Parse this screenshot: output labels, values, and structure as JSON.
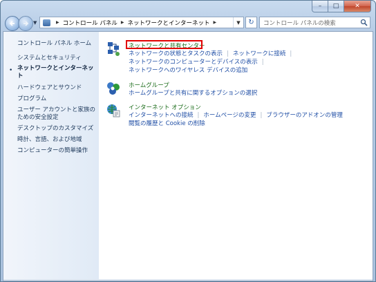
{
  "address": {
    "crumbs": [
      "コントロール パネル",
      "ネットワークとインターネット"
    ]
  },
  "search": {
    "placeholder": "コントロール パネルの検索"
  },
  "sidebar": {
    "items": [
      {
        "label": "コントロール パネル ホーム"
      },
      {
        "label": "システムとセキュリティ"
      },
      {
        "label_line1": "ネットワークとインターネッ",
        "label_line2": "ト"
      },
      {
        "label": "ハードウェアとサウンド"
      },
      {
        "label": "プログラム"
      },
      {
        "label_line1": "ユーザー アカウントと家族の",
        "label_line2": "ための安全設定"
      },
      {
        "label": "デスクトップのカスタマイズ"
      },
      {
        "label": "時計、言語、および地域"
      },
      {
        "label": "コンピューターの簡単操作"
      }
    ],
    "active_index": 2
  },
  "categories": [
    {
      "icon": "network-sharing-icon",
      "title": "ネットワークと共有センター",
      "highlighted": true,
      "links": [
        [
          "ネットワークの状態とタスクの表示",
          "ネットワークに接続"
        ],
        [
          "ネットワークのコンピューターとデバイスの表示"
        ],
        [
          "ネットワークへのワイヤレス デバイスの追加"
        ]
      ]
    },
    {
      "icon": "homegroup-icon",
      "title": "ホームグループ",
      "links": [
        [
          "ホームグループと共有に関するオプションの選択"
        ]
      ]
    },
    {
      "icon": "internet-options-icon",
      "title": "インターネット オプション",
      "links": [
        [
          "インターネットへの接続",
          "ホームページの変更",
          "ブラウザーのアドオンの管理"
        ],
        [
          "閲覧の履歴と Cookie の削除"
        ]
      ]
    }
  ],
  "colors": {
    "link": "#1f4ea5",
    "category_title": "#1a6b19",
    "highlight_border": "#e10000"
  }
}
